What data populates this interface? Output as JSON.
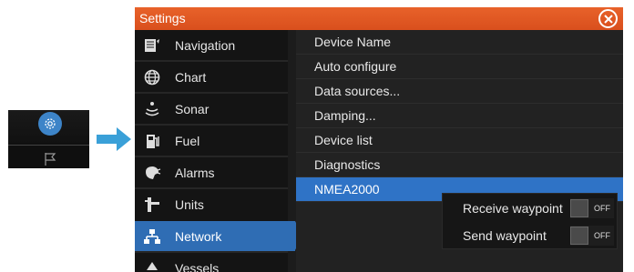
{
  "window": {
    "title": "Settings"
  },
  "sidebar": {
    "items": [
      {
        "label": "Navigation",
        "icon": "navigation-icon"
      },
      {
        "label": "Chart",
        "icon": "globe-icon"
      },
      {
        "label": "Sonar",
        "icon": "sonar-icon"
      },
      {
        "label": "Fuel",
        "icon": "fuel-pump-icon"
      },
      {
        "label": "Alarms",
        "icon": "alarm-icon"
      },
      {
        "label": "Units",
        "icon": "units-icon"
      },
      {
        "label": "Network",
        "icon": "network-icon",
        "selected": true
      },
      {
        "label": "Vessels",
        "icon": "vessel-icon"
      }
    ]
  },
  "content": {
    "options": [
      {
        "label": "Device Name"
      },
      {
        "label": "Auto configure"
      },
      {
        "label": "Data sources..."
      },
      {
        "label": "Damping..."
      },
      {
        "label": "Device list"
      },
      {
        "label": "Diagnostics"
      },
      {
        "label": "NMEA2000",
        "selected": true
      }
    ]
  },
  "nmea2000_popup": {
    "rows": [
      {
        "label": "Receive waypoint",
        "state": "OFF"
      },
      {
        "label": "Send waypoint",
        "state": "OFF"
      }
    ]
  },
  "colors": {
    "titlebar": "#e05a25",
    "selection": "#2f6db4",
    "home_button": "#3d84c8",
    "arrow": "#3aa0d8"
  }
}
